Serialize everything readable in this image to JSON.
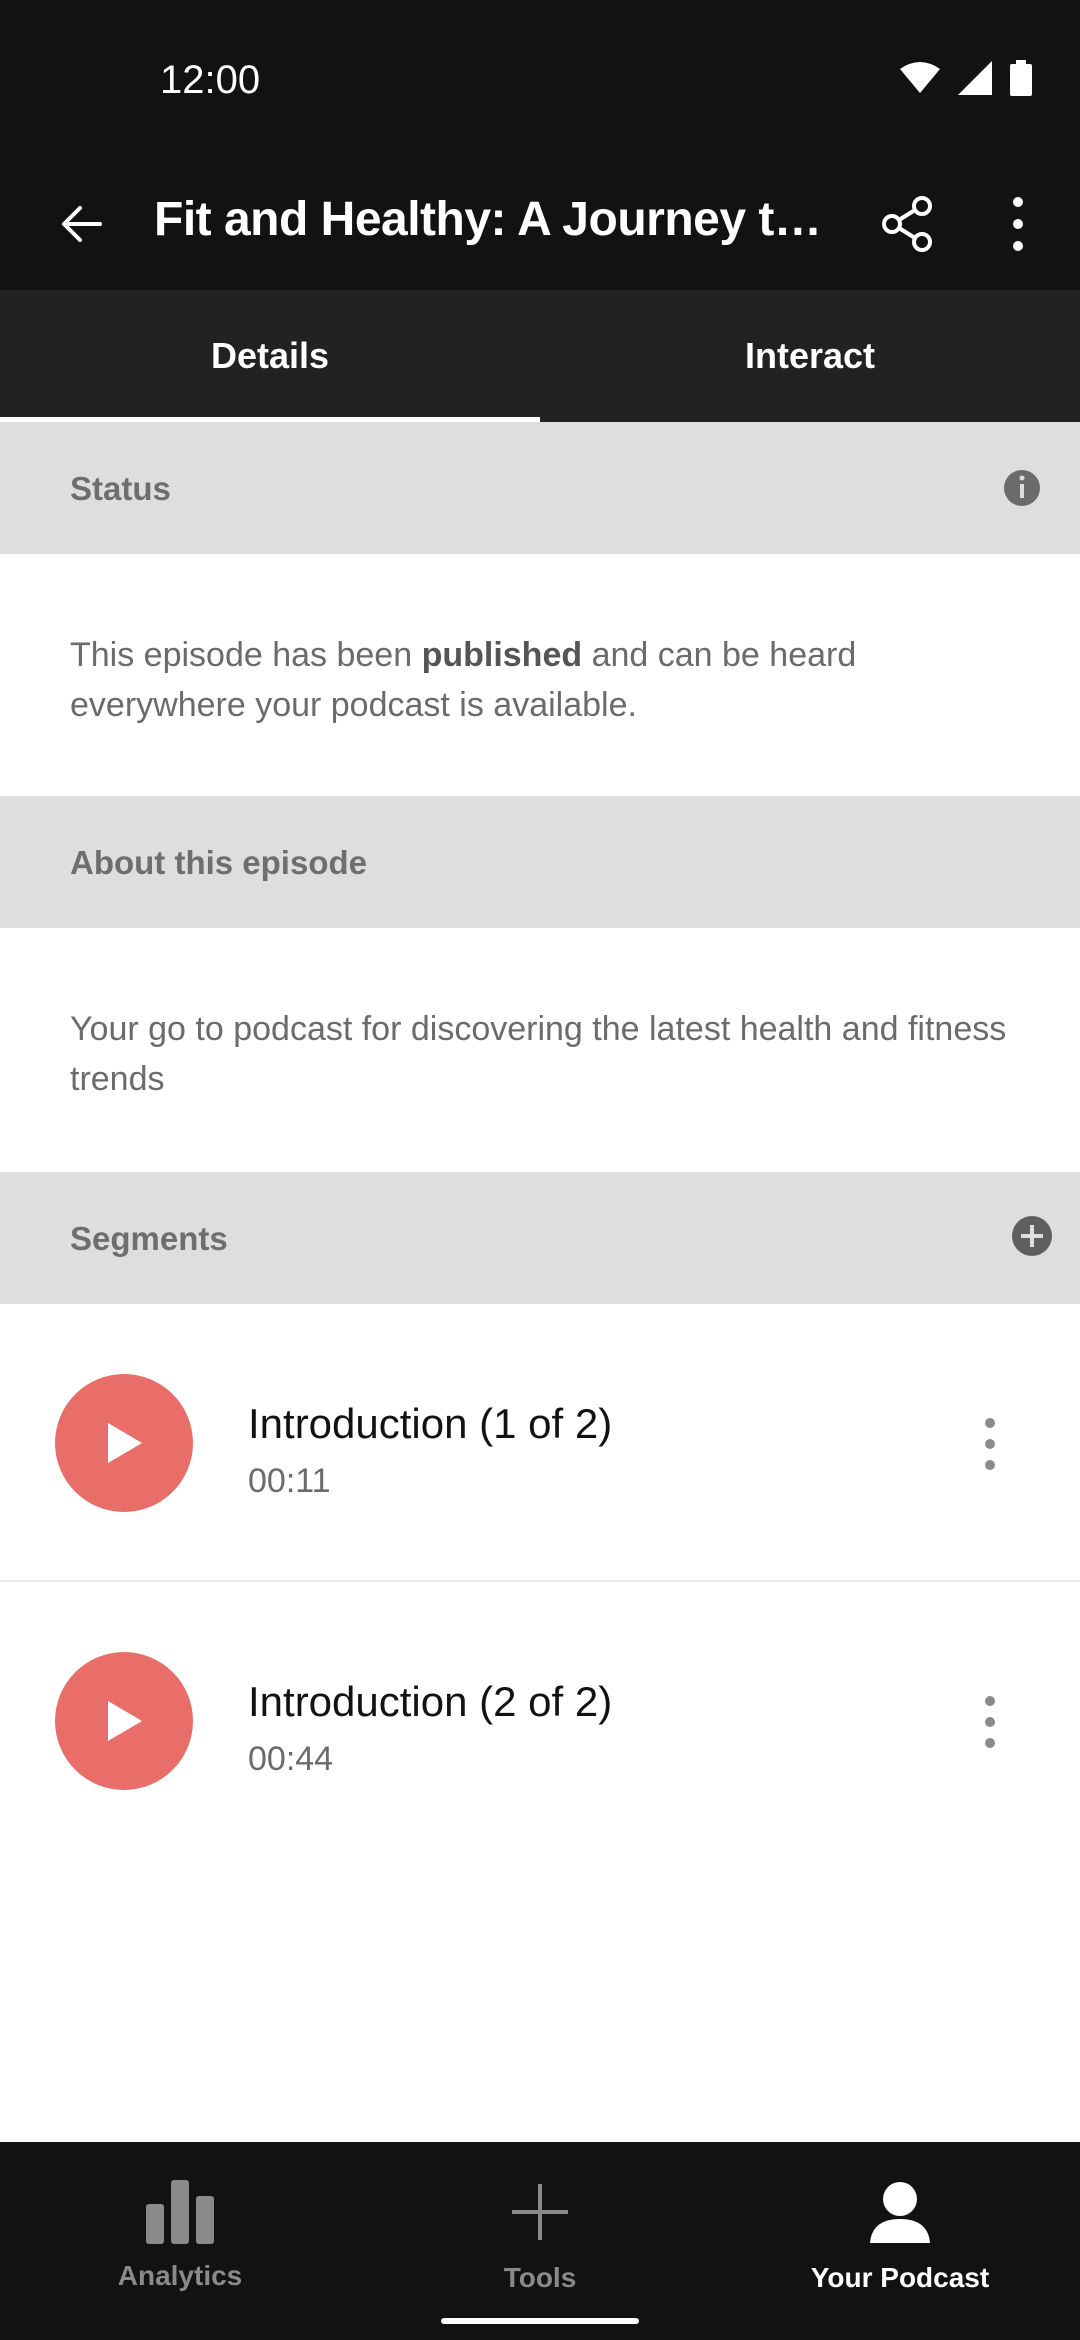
{
  "status_bar": {
    "time": "12:00"
  },
  "app_bar": {
    "title": "Fit and Healthy: A Journey to…",
    "back_icon": "arrow-left-icon",
    "share_icon": "share-icon",
    "more_icon": "more-vertical-icon"
  },
  "tabs": [
    {
      "label": "Details",
      "active": true
    },
    {
      "label": "Interact",
      "active": false
    }
  ],
  "status_section": {
    "header": "Status",
    "info_icon": "info-icon",
    "text_before": "This episode has been ",
    "text_bold": "published",
    "text_after": " and can be heard everywhere your podcast is available."
  },
  "about_section": {
    "header": "About this episode",
    "text": "Your go to podcast for discovering the latest health and fitness trends"
  },
  "segments_section": {
    "header": "Segments",
    "add_icon": "add-circle-icon",
    "items": [
      {
        "title": "Introduction (1 of 2)",
        "duration": "00:11"
      },
      {
        "title": "Introduction (2 of 2)",
        "duration": "00:44"
      }
    ]
  },
  "bottom_nav": [
    {
      "label": "Analytics",
      "icon": "bar-chart-icon",
      "active": false
    },
    {
      "label": "Tools",
      "icon": "plus-icon",
      "active": false
    },
    {
      "label": "Your Podcast",
      "icon": "person-icon",
      "active": true
    }
  ],
  "colors": {
    "dark_bg": "#121212",
    "tab_bg": "#222222",
    "section_header_bg": "#dedede",
    "play_accent": "#e96e6a"
  }
}
